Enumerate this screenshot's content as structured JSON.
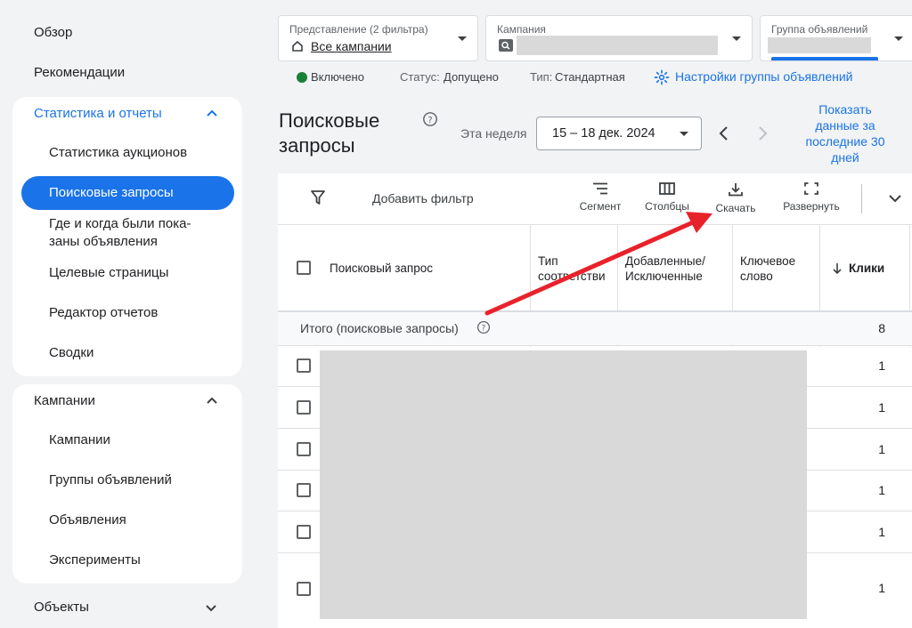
{
  "sidebar": {
    "overview": "Обзор",
    "recommendations": "Рекомендации",
    "stats_group": {
      "title": "Статистика и отчеты",
      "items": [
        "Статистика аукционов",
        "Поисковые запросы",
        "Где и когда были пока-\nзаны объявления",
        "Целевые страницы",
        "Редактор отчетов",
        "Сводки"
      ]
    },
    "campaigns_group": {
      "title": "Кампании",
      "items": [
        "Кампании",
        "Группы объявлений",
        "Объявления",
        "Эксперименты"
      ]
    },
    "objects": "Объекты"
  },
  "filters": {
    "view": {
      "label": "Представление (2 фильтра)",
      "value": "Все кампании"
    },
    "campaign": {
      "label": "Кампания"
    },
    "ad_group": {
      "label": "Группа объявлений"
    }
  },
  "status_bar": {
    "enabled": "Включено",
    "status_label": "Статус:",
    "status_value": "Допущено",
    "type_label": "Тип:",
    "type_value": "Стандартная",
    "settings_link": "Настройки группы объявлений"
  },
  "page": {
    "title_line1": "Поисковые",
    "title_line2": "запросы",
    "date_range_label": "Эта неделя",
    "date_range_value": "15 – 18 дек. 2024",
    "show_last_30": "Показать данные за последние 30 дней"
  },
  "toolbar": {
    "add_filter": "Добавить фильтр",
    "segment": "Сегмент",
    "columns": "Столбцы",
    "download": "Скачать",
    "expand": "Развернуть"
  },
  "table": {
    "headers": {
      "search_term": "Поисковый запрос",
      "match_type": "Тип\nсоответстви",
      "added_excluded": "Добавленные/\nИсключенные",
      "keyword": "Ключевое\nслово",
      "clicks": "Клики"
    },
    "total_label": "Итого (поисковые запросы)",
    "total_clicks": "8",
    "rows": [
      {
        "clicks": "1"
      },
      {
        "clicks": "1"
      },
      {
        "clicks": "1"
      },
      {
        "clicks": "1"
      },
      {
        "clicks": "1"
      },
      {
        "clicks": "1"
      }
    ]
  },
  "colors": {
    "accent": "#1a73e8",
    "enabled_green": "#188038",
    "annotation_arrow": "#e8222b"
  }
}
